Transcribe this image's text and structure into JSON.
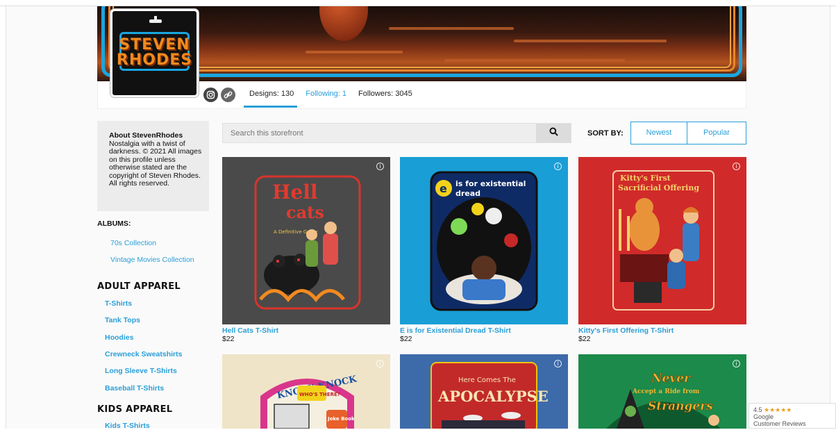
{
  "brand": {
    "logo_line1": "STEVEN",
    "logo_line2": "RHODES"
  },
  "stats": {
    "designs": "Designs: 130",
    "following": "Following: 1",
    "followers": "Followers: 3045"
  },
  "about": {
    "title": "About StevenRhodes",
    "text": "Nostalgia with a twist of darkness. © 2021 All images on this profile unless otherwise stated are the copyright of Steven Rhodes. All rights reserved."
  },
  "albums": {
    "heading": "ALBUMS:",
    "items": [
      "70s Collection",
      "Vintage Movies Collection"
    ]
  },
  "adult": {
    "heading": "ADULT APPAREL",
    "items": [
      "T-Shirts",
      "Tank Tops",
      "Hoodies",
      "Crewneck Sweatshirts",
      "Long Sleeve T-Shirts",
      "Baseball T-Shirts"
    ]
  },
  "kids": {
    "heading": "KIDS APPAREL",
    "items": [
      "Kids T-Shirts"
    ]
  },
  "search": {
    "placeholder": "Search this storefront"
  },
  "sort": {
    "label": "SORT BY:",
    "options": [
      "Newest",
      "Popular"
    ]
  },
  "products": [
    {
      "title": "Hell Cats T-Shirt",
      "price": "$22",
      "bg": "#4a4a4a",
      "art1": "Hell",
      "art2": "cats",
      "art3": "A Definitive Guide"
    },
    {
      "title": "E is for Existential Dread T-Shirt",
      "price": "$22",
      "bg": "#1a9ed6",
      "art1": "is for existential",
      "art2": "dread",
      "art3": "e"
    },
    {
      "title": "Kitty's First Offering T-Shirt",
      "price": "$22",
      "bg": "#d12a2a",
      "art1": "Kitty's First",
      "art2": "Sacrificial Offering",
      "art3": ""
    },
    {
      "title": "",
      "price": "",
      "bg": "#efe4c8",
      "art1": "KNOCK KNOCK",
      "art2": "WHO'S THERE?",
      "art3": "Joke Book"
    },
    {
      "title": "",
      "price": "",
      "bg": "#3d6aa8",
      "art1": "Here Comes The",
      "art2": "APOCALYPSE",
      "art3": ""
    },
    {
      "title": "",
      "price": "",
      "bg": "#1c8a4a",
      "art1": "Never",
      "art2": "Accept a Ride from",
      "art3": "Strangers"
    }
  ],
  "review_badge": {
    "rating": "4.5",
    "stars": "★★★★★",
    "line1": "Google",
    "line2": "Customer Reviews"
  }
}
